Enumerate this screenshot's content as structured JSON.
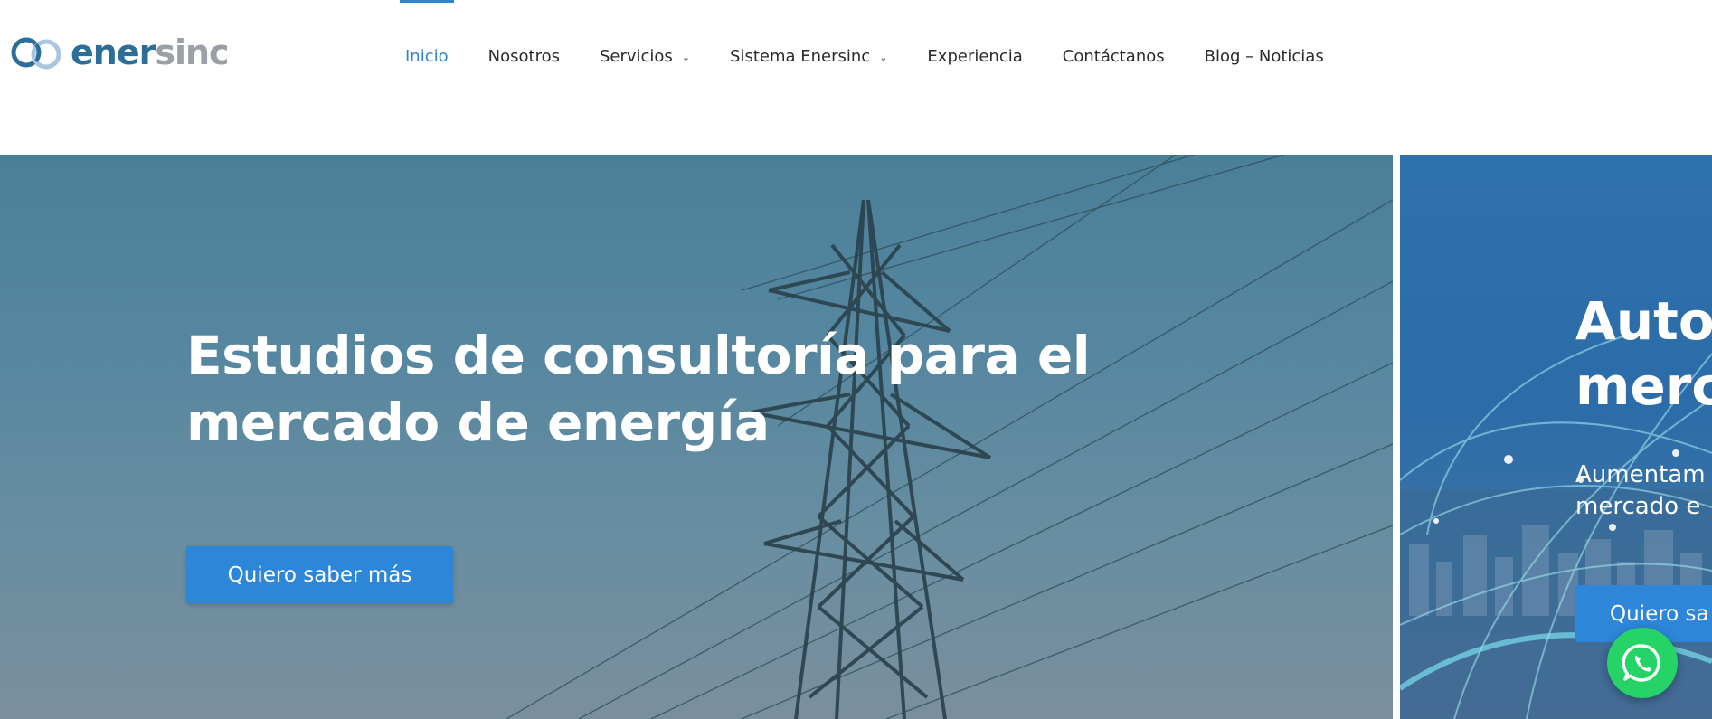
{
  "brand": {
    "name_part1": "ener",
    "name_part2": "sinc",
    "primary_color": "#2c6e98",
    "secondary_color": "#9aa0a6",
    "logo_icon": "infinity-icon"
  },
  "nav": {
    "items": [
      {
        "label": "Inicio",
        "active": true,
        "has_dropdown": false
      },
      {
        "label": "Nosotros",
        "active": false,
        "has_dropdown": false
      },
      {
        "label": "Servicios",
        "active": false,
        "has_dropdown": true
      },
      {
        "label": "Sistema Enersinc",
        "active": false,
        "has_dropdown": true
      },
      {
        "label": "Experiencia",
        "active": false,
        "has_dropdown": false
      },
      {
        "label": "Contáctanos",
        "active": false,
        "has_dropdown": false
      },
      {
        "label": "Blog – Noticias",
        "active": false,
        "has_dropdown": false
      }
    ],
    "active_color": "#2f83cf",
    "dropdown_icon": "chevron-down-icon"
  },
  "hero": {
    "slide_current": {
      "title": "Estudios de consultoría para el mercado de energía",
      "button_label": "Quiero saber más",
      "background_icon": "transmission-tower-icon"
    },
    "slide_next": {
      "title": "Auto\nmerc",
      "subtitle": "Aumentam\nmercado e",
      "button_label": "Quiero sa"
    },
    "button_color": "#2d86d8"
  },
  "floating": {
    "whatsapp_icon": "whatsapp-icon",
    "whatsapp_color": "#25d366"
  }
}
